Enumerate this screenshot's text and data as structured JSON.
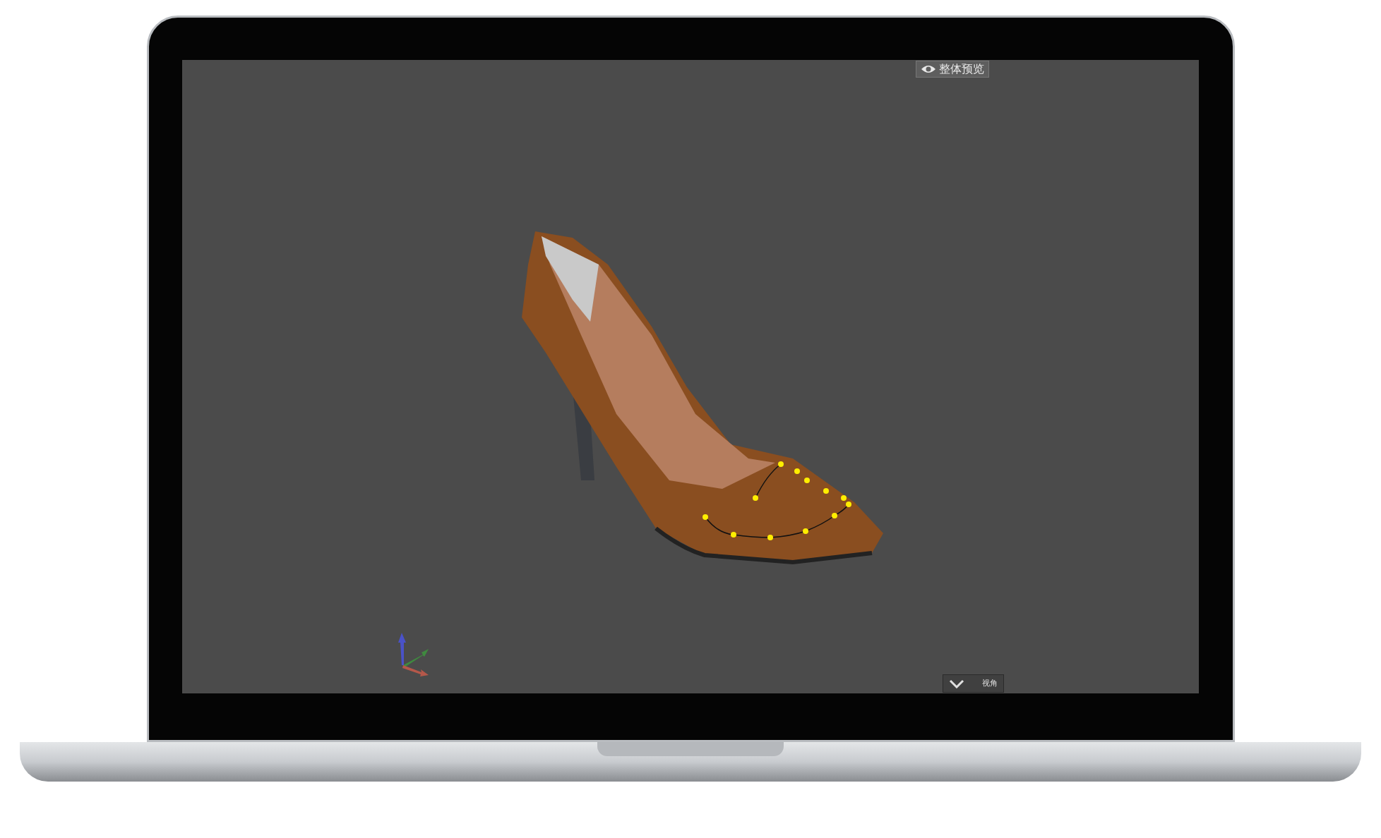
{
  "viewport": {
    "preview_button": {
      "label": "整体预览"
    },
    "view_button": {
      "label": "视角"
    }
  }
}
